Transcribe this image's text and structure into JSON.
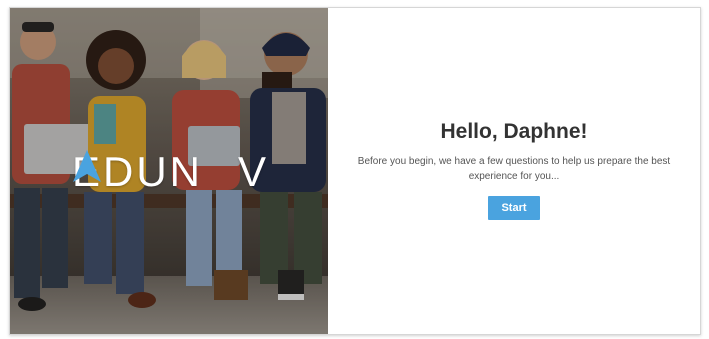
{
  "hero": {
    "logo_text_left": "EDUN",
    "logo_text_right": "V",
    "logo_mark_icon": "triangle-a-icon",
    "accent_color": "#4aa3df"
  },
  "welcome": {
    "greeting": "Hello, Daphne!",
    "message": "Before you begin, we have a few questions to help us prepare the best experience for you...",
    "start_label": "Start"
  }
}
